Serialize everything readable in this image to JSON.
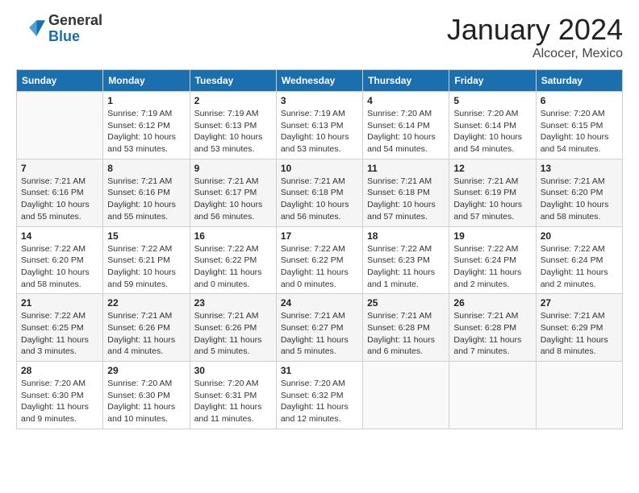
{
  "header": {
    "logo_general": "General",
    "logo_blue": "Blue",
    "month_title": "January 2024",
    "location": "Alcocer, Mexico"
  },
  "weekdays": [
    "Sunday",
    "Monday",
    "Tuesday",
    "Wednesday",
    "Thursday",
    "Friday",
    "Saturday"
  ],
  "weeks": [
    [
      {
        "day": "",
        "info": ""
      },
      {
        "day": "1",
        "info": "Sunrise: 7:19 AM\nSunset: 6:12 PM\nDaylight: 10 hours\nand 53 minutes."
      },
      {
        "day": "2",
        "info": "Sunrise: 7:19 AM\nSunset: 6:13 PM\nDaylight: 10 hours\nand 53 minutes."
      },
      {
        "day": "3",
        "info": "Sunrise: 7:19 AM\nSunset: 6:13 PM\nDaylight: 10 hours\nand 53 minutes."
      },
      {
        "day": "4",
        "info": "Sunrise: 7:20 AM\nSunset: 6:14 PM\nDaylight: 10 hours\nand 54 minutes."
      },
      {
        "day": "5",
        "info": "Sunrise: 7:20 AM\nSunset: 6:14 PM\nDaylight: 10 hours\nand 54 minutes."
      },
      {
        "day": "6",
        "info": "Sunrise: 7:20 AM\nSunset: 6:15 PM\nDaylight: 10 hours\nand 54 minutes."
      }
    ],
    [
      {
        "day": "7",
        "info": "Sunrise: 7:21 AM\nSunset: 6:16 PM\nDaylight: 10 hours\nand 55 minutes."
      },
      {
        "day": "8",
        "info": "Sunrise: 7:21 AM\nSunset: 6:16 PM\nDaylight: 10 hours\nand 55 minutes."
      },
      {
        "day": "9",
        "info": "Sunrise: 7:21 AM\nSunset: 6:17 PM\nDaylight: 10 hours\nand 56 minutes."
      },
      {
        "day": "10",
        "info": "Sunrise: 7:21 AM\nSunset: 6:18 PM\nDaylight: 10 hours\nand 56 minutes."
      },
      {
        "day": "11",
        "info": "Sunrise: 7:21 AM\nSunset: 6:18 PM\nDaylight: 10 hours\nand 57 minutes."
      },
      {
        "day": "12",
        "info": "Sunrise: 7:21 AM\nSunset: 6:19 PM\nDaylight: 10 hours\nand 57 minutes."
      },
      {
        "day": "13",
        "info": "Sunrise: 7:21 AM\nSunset: 6:20 PM\nDaylight: 10 hours\nand 58 minutes."
      }
    ],
    [
      {
        "day": "14",
        "info": "Sunrise: 7:22 AM\nSunset: 6:20 PM\nDaylight: 10 hours\nand 58 minutes."
      },
      {
        "day": "15",
        "info": "Sunrise: 7:22 AM\nSunset: 6:21 PM\nDaylight: 10 hours\nand 59 minutes."
      },
      {
        "day": "16",
        "info": "Sunrise: 7:22 AM\nSunset: 6:22 PM\nDaylight: 11 hours\nand 0 minutes."
      },
      {
        "day": "17",
        "info": "Sunrise: 7:22 AM\nSunset: 6:22 PM\nDaylight: 11 hours\nand 0 minutes."
      },
      {
        "day": "18",
        "info": "Sunrise: 7:22 AM\nSunset: 6:23 PM\nDaylight: 11 hours\nand 1 minute."
      },
      {
        "day": "19",
        "info": "Sunrise: 7:22 AM\nSunset: 6:24 PM\nDaylight: 11 hours\nand 2 minutes."
      },
      {
        "day": "20",
        "info": "Sunrise: 7:22 AM\nSunset: 6:24 PM\nDaylight: 11 hours\nand 2 minutes."
      }
    ],
    [
      {
        "day": "21",
        "info": "Sunrise: 7:22 AM\nSunset: 6:25 PM\nDaylight: 11 hours\nand 3 minutes."
      },
      {
        "day": "22",
        "info": "Sunrise: 7:21 AM\nSunset: 6:26 PM\nDaylight: 11 hours\nand 4 minutes."
      },
      {
        "day": "23",
        "info": "Sunrise: 7:21 AM\nSunset: 6:26 PM\nDaylight: 11 hours\nand 5 minutes."
      },
      {
        "day": "24",
        "info": "Sunrise: 7:21 AM\nSunset: 6:27 PM\nDaylight: 11 hours\nand 5 minutes."
      },
      {
        "day": "25",
        "info": "Sunrise: 7:21 AM\nSunset: 6:28 PM\nDaylight: 11 hours\nand 6 minutes."
      },
      {
        "day": "26",
        "info": "Sunrise: 7:21 AM\nSunset: 6:28 PM\nDaylight: 11 hours\nand 7 minutes."
      },
      {
        "day": "27",
        "info": "Sunrise: 7:21 AM\nSunset: 6:29 PM\nDaylight: 11 hours\nand 8 minutes."
      }
    ],
    [
      {
        "day": "28",
        "info": "Sunrise: 7:20 AM\nSunset: 6:30 PM\nDaylight: 11 hours\nand 9 minutes."
      },
      {
        "day": "29",
        "info": "Sunrise: 7:20 AM\nSunset: 6:30 PM\nDaylight: 11 hours\nand 10 minutes."
      },
      {
        "day": "30",
        "info": "Sunrise: 7:20 AM\nSunset: 6:31 PM\nDaylight: 11 hours\nand 11 minutes."
      },
      {
        "day": "31",
        "info": "Sunrise: 7:20 AM\nSunset: 6:32 PM\nDaylight: 11 hours\nand 12 minutes."
      },
      {
        "day": "",
        "info": ""
      },
      {
        "day": "",
        "info": ""
      },
      {
        "day": "",
        "info": ""
      }
    ]
  ]
}
